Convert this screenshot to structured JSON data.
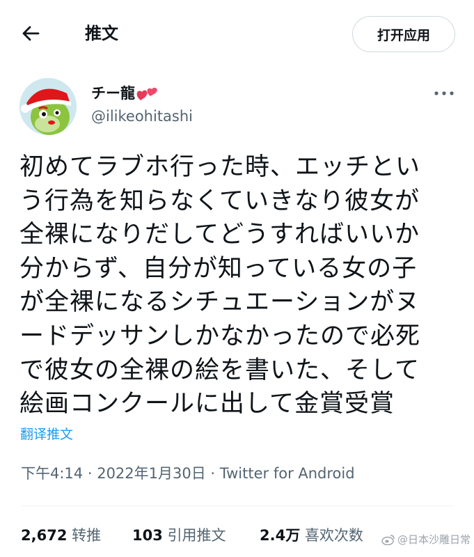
{
  "header": {
    "title": "推文",
    "open_app_label": "打开应用"
  },
  "author": {
    "name": "チー龍",
    "handle": "@ilikeohitashi"
  },
  "tweet": {
    "lines": [
      "初めてラブホ行った時、エッチとい",
      "う行為を知らなくていきなり彼女が",
      "全裸になりだしてどうすればいいか",
      "分からず、自分が知っている女の子",
      "が全裸になるシチュエーションがヌ",
      "ードデッサンしかなかったので必死",
      "で彼女の全裸の絵を書いた、そして",
      "絵画コンクールに出して金賞受賞"
    ],
    "translate_label": "翻译推文"
  },
  "meta": {
    "time": "下午4:14",
    "date": "2022年1月30日",
    "separator": " · ",
    "source": "Twitter for Android"
  },
  "stats": {
    "retweets_count": "2,672",
    "retweets_label": "转推",
    "quotes_count": "103",
    "quotes_label": "引用推文",
    "likes_count": "2.4万",
    "likes_label": "喜欢次数"
  },
  "watermark": {
    "text": "@日本沙雕日常"
  },
  "icons": {
    "back": "arrow-left-icon",
    "more": "more-horizontal-icon",
    "hearts": "two-hearts-emoji",
    "watermark": "weibo-logo-icon"
  },
  "colors": {
    "link": "#1d9bf0",
    "secondary_text": "#536471",
    "primary_text": "#0f1419"
  }
}
